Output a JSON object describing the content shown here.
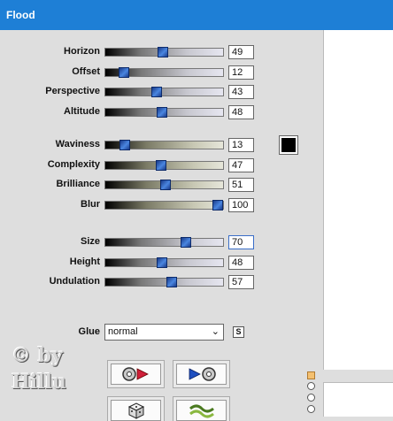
{
  "window": {
    "title": "Flood"
  },
  "sliders_group1": [
    {
      "label": "Horizon",
      "value": "49",
      "level": 49,
      "track": "gray",
      "name": "horizon"
    },
    {
      "label": "Offset",
      "value": "12",
      "level": 12,
      "track": "gray",
      "name": "offset"
    },
    {
      "label": "Perspective",
      "value": "43",
      "level": 43,
      "track": "gray",
      "name": "perspective"
    },
    {
      "label": "Altitude",
      "value": "48",
      "level": 48,
      "track": "gray",
      "name": "altitude"
    }
  ],
  "sliders_group2": [
    {
      "label": "Waviness",
      "value": "13",
      "level": 13,
      "track": "olive",
      "name": "waviness"
    },
    {
      "label": "Complexity",
      "value": "47",
      "level": 47,
      "track": "olive",
      "name": "complexity"
    },
    {
      "label": "Brilliance",
      "value": "51",
      "level": 51,
      "track": "olive",
      "name": "brilliance"
    },
    {
      "label": "Blur",
      "value": "100",
      "level": 100,
      "track": "olive",
      "name": "blur"
    }
  ],
  "sliders_group3": [
    {
      "label": "Size",
      "value": "70",
      "level": 70,
      "track": "gray",
      "name": "size",
      "active": true
    },
    {
      "label": "Height",
      "value": "48",
      "level": 48,
      "track": "gray",
      "name": "height"
    },
    {
      "label": "Undulation",
      "value": "57",
      "level": 57,
      "track": "gray",
      "name": "undulation"
    }
  ],
  "color": {
    "swatch": "#000000"
  },
  "glue": {
    "label": "Glue",
    "selected": "normal",
    "s_button": "S"
  },
  "buttons": {
    "load_preset_icon": "disk-arrow-right-icon",
    "save_preset_icon": "arrow-disk-icon",
    "random_icon": "dice-icon",
    "reset_icon": "wave-icon"
  },
  "watermark": {
    "line1": "© by",
    "line2": "Hillu"
  }
}
